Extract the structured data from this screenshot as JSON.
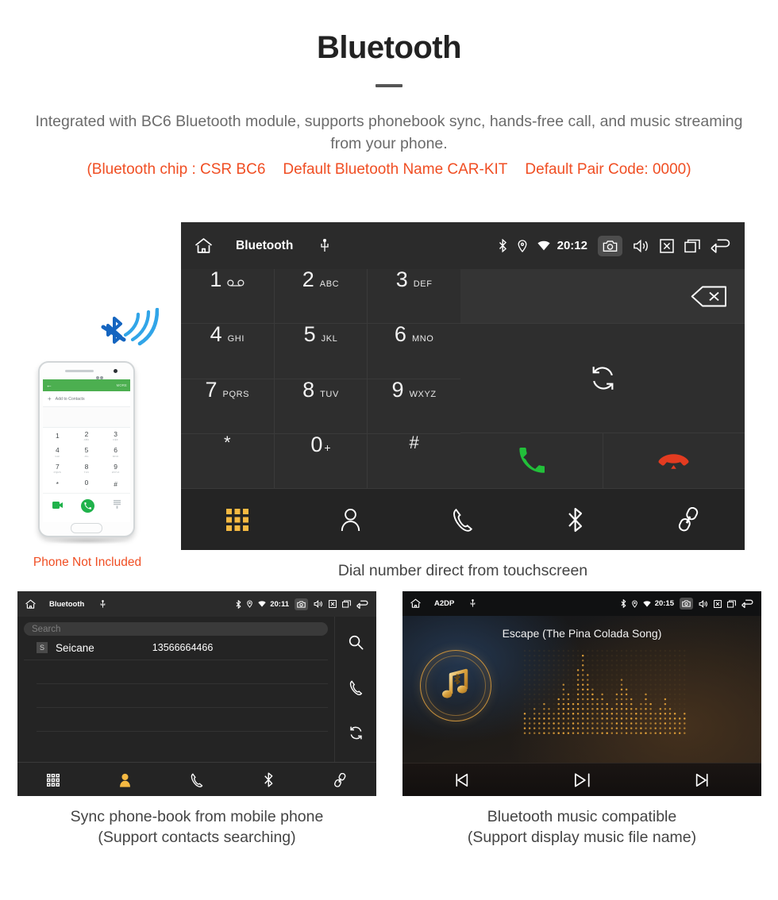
{
  "header": {
    "title": "Bluetooth",
    "intro": "Integrated with BC6 Bluetooth module, supports phonebook sync, hands-free call, and music streaming from your phone.",
    "spec_left": "(Bluetooth chip : CSR BC6",
    "spec_mid": "Default Bluetooth Name CAR-KIT",
    "spec_right": "Default Pair Code: 0000)",
    "accent_color": "#f04e23"
  },
  "dialer": {
    "statusbar": {
      "title": "Bluetooth",
      "time": "20:12",
      "icons": [
        "home-icon",
        "usb-icon",
        "bluetooth-icon",
        "location-icon",
        "wifi-icon",
        "camera-icon",
        "volume-icon",
        "close-icon",
        "recents-icon",
        "back-icon"
      ]
    },
    "keys": [
      {
        "num": "1",
        "sub": "",
        "type": "voicemail"
      },
      {
        "num": "2",
        "sub": "ABC",
        "type": "digit"
      },
      {
        "num": "3",
        "sub": "DEF",
        "type": "digit"
      },
      {
        "num": "4",
        "sub": "GHI",
        "type": "digit"
      },
      {
        "num": "5",
        "sub": "JKL",
        "type": "digit"
      },
      {
        "num": "6",
        "sub": "MNO",
        "type": "digit"
      },
      {
        "num": "7",
        "sub": "PQRS",
        "type": "digit"
      },
      {
        "num": "8",
        "sub": "TUV",
        "type": "digit"
      },
      {
        "num": "9",
        "sub": "WXYZ",
        "type": "digit"
      },
      {
        "num": "*",
        "sub": "",
        "type": "symbol"
      },
      {
        "num": "0",
        "sub": "+",
        "type": "zero"
      },
      {
        "num": "#",
        "sub": "",
        "type": "symbol"
      }
    ],
    "input_value": "",
    "right_icons": [
      "backspace-icon",
      "sync-audio-icon",
      "call-icon",
      "hangup-icon"
    ],
    "nav": [
      "keypad-icon",
      "contacts-icon",
      "call-log-icon",
      "bluetooth-icon",
      "link-icon"
    ],
    "nav_active": "keypad-icon",
    "active_color": "#f5b942",
    "call_color": "#22c03a",
    "hangup_color": "#e33b20",
    "caption": "Dial number direct from touchscreen"
  },
  "phone_mock": {
    "back_label": "←",
    "more_label": "MORE",
    "add_contacts": "Add to Contacts",
    "keys": [
      {
        "n": "1",
        "l": ""
      },
      {
        "n": "2",
        "l": "ABC"
      },
      {
        "n": "3",
        "l": "DEF"
      },
      {
        "n": "4",
        "l": "GHI"
      },
      {
        "n": "5",
        "l": "JKL"
      },
      {
        "n": "6",
        "l": "MNO"
      },
      {
        "n": "7",
        "l": "PQRS"
      },
      {
        "n": "8",
        "l": "TUV"
      },
      {
        "n": "9",
        "l": "WXYZ"
      },
      {
        "n": "*",
        "l": ""
      },
      {
        "n": "0",
        "l": "+"
      },
      {
        "n": "#",
        "l": ""
      }
    ],
    "note": "Phone Not Included",
    "note_color": "#f04e23"
  },
  "phonebook": {
    "statusbar": {
      "title": "Bluetooth",
      "time": "20:11"
    },
    "search_placeholder": "Search",
    "contacts": [
      {
        "initial": "S",
        "name": "Seicane",
        "number": "13566664466"
      }
    ],
    "empty_rows": 3,
    "side_icons": [
      "search-icon",
      "call-icon",
      "sync-icon"
    ],
    "nav": [
      "keypad-icon",
      "contacts-icon",
      "call-log-icon",
      "bluetooth-icon",
      "link-icon"
    ],
    "nav_active": "contacts-icon",
    "caption_line1": "Sync phone-book from mobile phone",
    "caption_line2": "(Support contacts searching)"
  },
  "music": {
    "statusbar": {
      "title": "A2DP",
      "time": "20:15"
    },
    "track_title": "Escape (The Pina Colada Song)",
    "controls": [
      "previous-icon",
      "play-pause-icon",
      "next-icon"
    ],
    "caption_line1": "Bluetooth music compatible",
    "caption_line2": "(Support display music file name)"
  }
}
